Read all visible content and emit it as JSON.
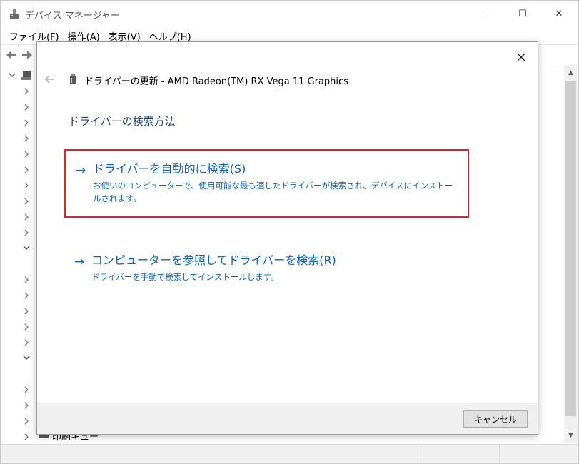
{
  "window": {
    "title": "デバイス マネージャー",
    "controls": {
      "minimize": "—",
      "maximize": "☐",
      "close": "✕"
    }
  },
  "menu": [
    {
      "label": "ファイル(F)"
    },
    {
      "label": "操作(A)"
    },
    {
      "label": "表示(V)"
    },
    {
      "label": "ヘルプ(H)"
    }
  ],
  "tree": {
    "visible_last_item": "印刷キュー"
  },
  "dialog": {
    "header_title": "ドライバーの更新 - AMD Radeon(TM) RX Vega 11 Graphics",
    "heading": "ドライバーの検索方法",
    "options": [
      {
        "title": "ドライバーを自動的に検索(S)",
        "description": "お使いのコンピューターで、使用可能な最も適したドライバーが検索され、デバイスにインストールされます。",
        "highlighted": true
      },
      {
        "title": "コンピューターを参照してドライバーを検索(R)",
        "description": "ドライバーを手動で検索してインストールします。",
        "highlighted": false
      }
    ],
    "cancel_label": "キャンセル",
    "close_glyph": "✕"
  },
  "colors": {
    "link_blue": "#0a64c8",
    "heading_blue": "#1a3f7a",
    "highlight_red": "#d9262c"
  }
}
